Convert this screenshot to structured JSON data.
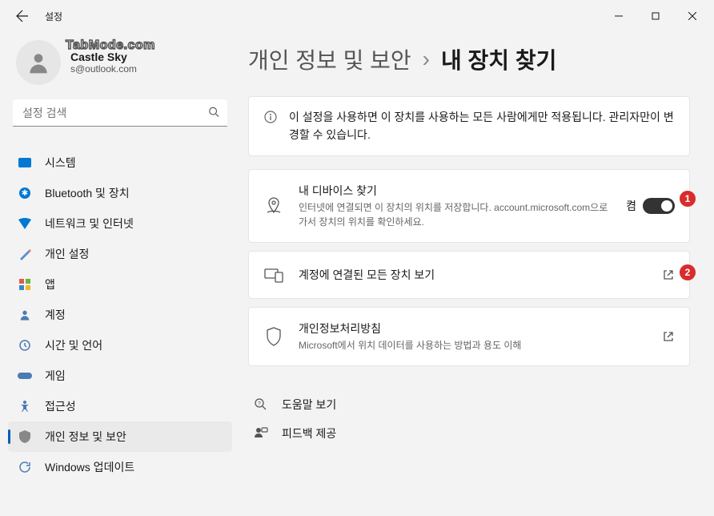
{
  "app_title": "설정",
  "watermark": "TabMode.com",
  "user": {
    "name": "Castle Sky",
    "email": "s@outlook.com"
  },
  "search": {
    "placeholder": "설정 검색"
  },
  "sidebar": {
    "items": [
      {
        "icon": "system-icon",
        "label": "시스템"
      },
      {
        "icon": "bluetooth-icon",
        "label": "Bluetooth 및 장치"
      },
      {
        "icon": "network-icon",
        "label": "네트워크 및 인터넷"
      },
      {
        "icon": "personalize-icon",
        "label": "개인 설정"
      },
      {
        "icon": "apps-icon",
        "label": "앱"
      },
      {
        "icon": "account-icon",
        "label": "계정"
      },
      {
        "icon": "time-icon",
        "label": "시간 및 언어"
      },
      {
        "icon": "game-icon",
        "label": "게임"
      },
      {
        "icon": "accessibility-icon",
        "label": "접근성"
      },
      {
        "icon": "privacy-icon",
        "label": "개인 정보 및 보안"
      },
      {
        "icon": "update-icon",
        "label": "Windows 업데이트"
      }
    ],
    "selected_index": 9
  },
  "breadcrumb": {
    "parent": "개인 정보 및 보안",
    "current": "내 장치 찾기"
  },
  "info_banner": "이 설정을 사용하면 이 장치를 사용하는 모든 사람에게만 적용됩니다. 관리자만이 변경할 수 있습니다.",
  "cards": [
    {
      "title": "내 디바이스 찾기",
      "desc": "인터넷에 연결되면 이 장치의 위치를 저장합니다. account.microsoft.com으로 가서 장치의 위치를 확인하세요.",
      "toggle_label": "켬",
      "toggle_on": true,
      "badge": "1"
    },
    {
      "title": "계정에 연결된 모든 장치 보기",
      "desc": "",
      "action": "external",
      "badge": "2"
    },
    {
      "title": "개인정보처리방침",
      "desc": "Microsoft에서 위치 데이터를 사용하는 방법과 용도 이해",
      "action": "external"
    }
  ],
  "help_links": [
    {
      "icon": "help-icon",
      "label": "도움말 보기"
    },
    {
      "icon": "feedback-icon",
      "label": "피드백 제공"
    }
  ]
}
